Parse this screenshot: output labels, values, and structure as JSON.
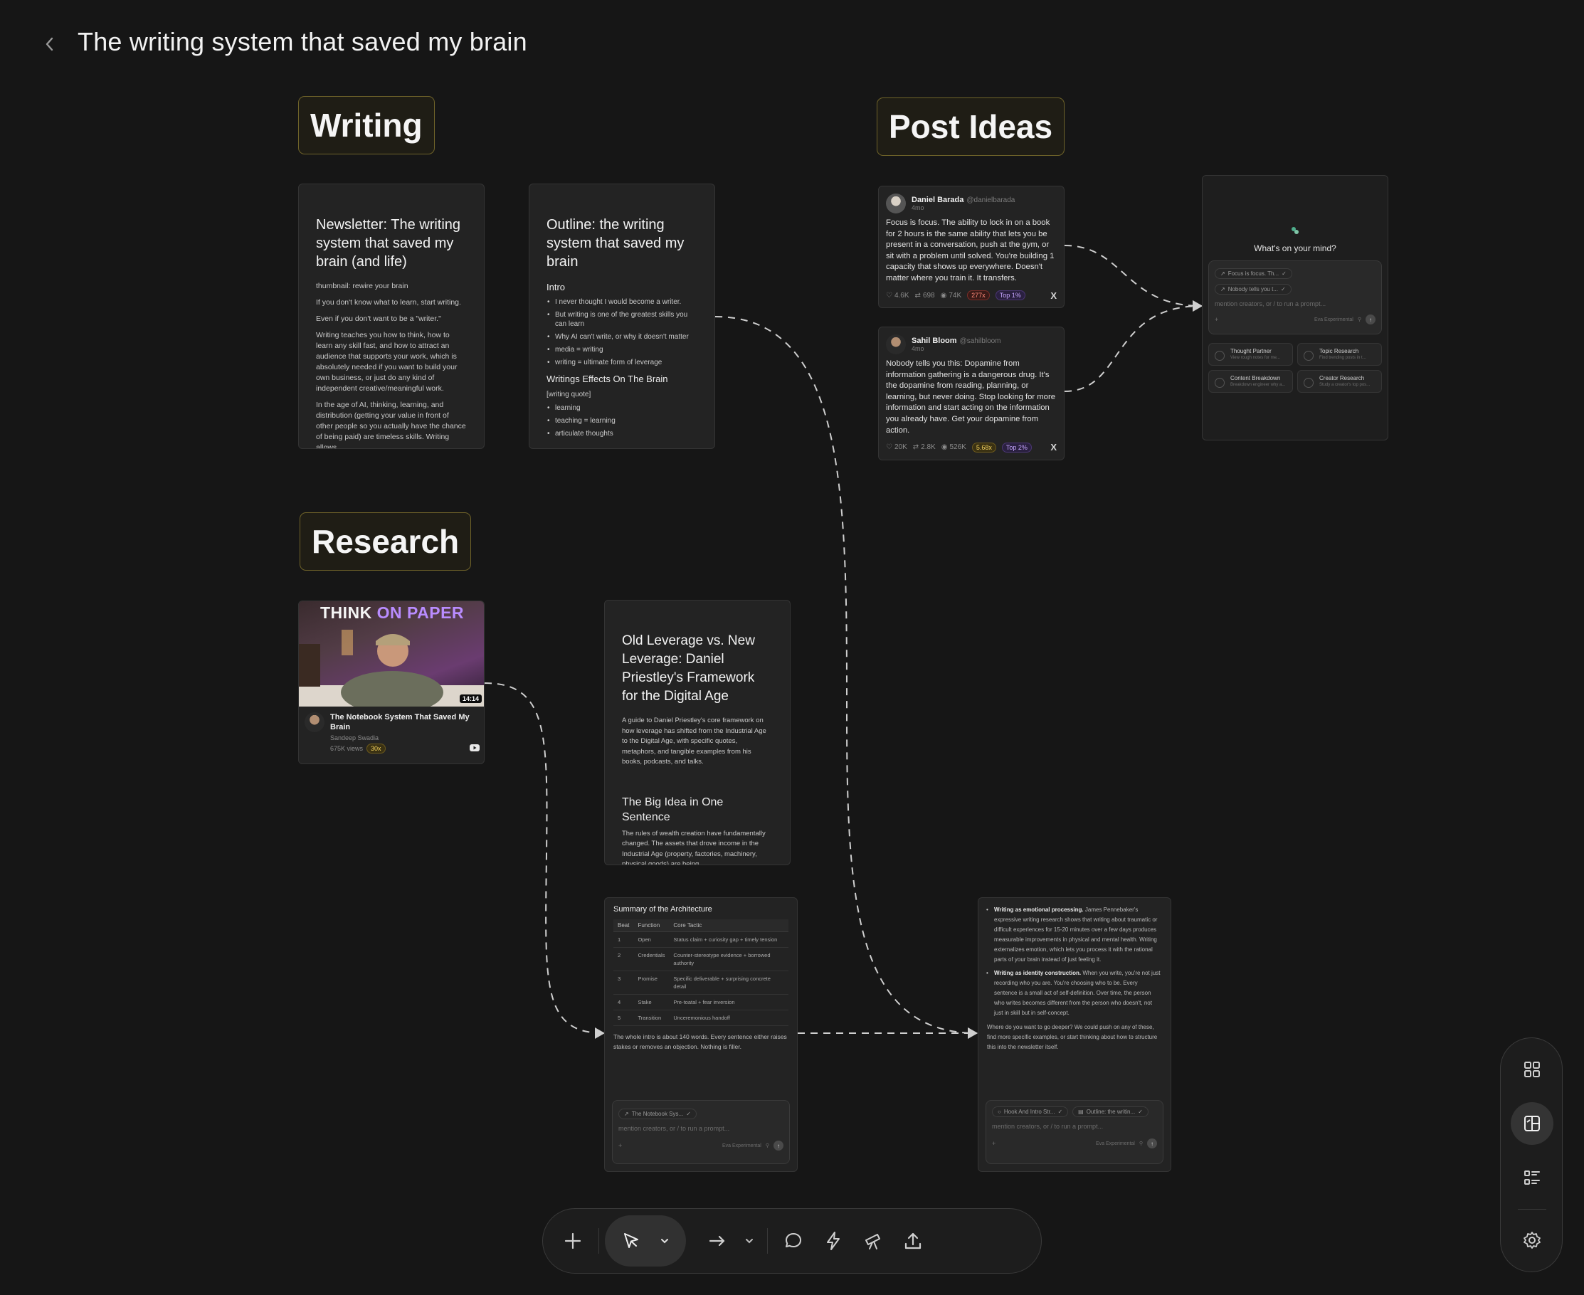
{
  "header": {
    "title": "The writing system that saved my brain"
  },
  "sections": {
    "writing": "Writing",
    "post_ideas": "Post Ideas",
    "research": "Research"
  },
  "newsletter_card": {
    "title": "Newsletter: The writing system that saved my brain (and life)",
    "paragraphs": [
      "thumbnail: rewire your brain",
      "If you don't know what to learn, start writing.",
      "Even if you don't want to be a \"writer.\"",
      "Writing teaches you how to think, how to learn any skill fast, and how to attract an audience that supports your work, which is absolutely needed if you want to build your own business, or just do any kind of independent creative/meaningful work.",
      "In the age of AI, thinking, learning, and distribution (getting your value in front of other people so you actually have the chance of being paid) are timeless skills. Writing allows"
    ]
  },
  "outline_card": {
    "title": "Outline: the writing system that saved my brain",
    "intro_heading": "Intro",
    "intro_items": [
      "I never thought I would become a writer.",
      "But writing is one of the greatest skills you can learn",
      "Why AI can't write, or why it doesn't matter",
      "media = writing",
      "writing = ultimate form of leverage"
    ],
    "effects_heading": "Writings Effects On The Brain",
    "effects_quote": "[writing quote]",
    "effects_items": [
      "learning",
      "teaching = learning",
      "articulate thoughts"
    ]
  },
  "tweets": [
    {
      "name": "Daniel Barada",
      "handle": "@danielbarada",
      "time": "4mo",
      "body": "Focus is focus. The ability to lock in on a book for 2 hours is the same ability that lets you be present in a conversation, push at the gym, or sit with a problem until solved. You're building 1 capacity that shows up everywhere. Doesn't matter where you train it. It transfers.",
      "likes": "4.6K",
      "reposts": "698",
      "views": "74K",
      "badge1": "277x",
      "badge2": "Top 1%",
      "x_label": "X"
    },
    {
      "name": "Sahil Bloom",
      "handle": "@sahilbloom",
      "time": "4mo",
      "body": "Nobody tells you this: Dopamine from information gathering is a dangerous drug. It's the dopamine from reading, planning, or learning, but never doing. Stop looking for more information and start acting on the information you already have. Get your dopamine from action.",
      "likes": "20K",
      "reposts": "2.8K",
      "views": "526K",
      "badge1": "5.68x",
      "badge2": "Top 2%",
      "x_label": "X"
    }
  ],
  "mind_panel": {
    "question": "What's on your mind?",
    "chip1": "Focus is focus. Th...",
    "chip2": "Nobody tells you t...",
    "placeholder": "mention creators, or / to run a prompt...",
    "model": "Eva Experimental",
    "tools": [
      {
        "title": "Thought Partner",
        "sub": "View rough notes for me..."
      },
      {
        "title": "Topic Research",
        "sub": "Find trending posts in t..."
      },
      {
        "title": "Content Breakdown",
        "sub": "Breakdown engineer why a..."
      },
      {
        "title": "Creator Research",
        "sub": "Study a creator's top pos..."
      }
    ]
  },
  "video_card": {
    "thumb_title_a": "THINK ",
    "thumb_title_b": "ON PAPER",
    "duration": "14:14",
    "title": "The Notebook System That Saved My Brain",
    "channel": "Sandeep Swadia",
    "views": "675K views",
    "badge": "30x"
  },
  "leverage_card": {
    "title": "Old Leverage vs. New Leverage: Daniel Priestley's Framework for the Digital Age",
    "desc": "A guide to Daniel Priestley's core framework on how leverage has shifted from the Industrial Age to the Digital Age, with specific quotes, metaphors, and tangible examples from his books, podcasts, and talks.",
    "subheading": "The Big Idea in One Sentence",
    "subtext": "The rules of wealth creation have fundamentally changed. The assets that drove income in the Industrial Age (property, factories, machinery, physical goods) are being"
  },
  "architecture_card": {
    "title": "Summary of the Architecture",
    "columns": [
      "Beat",
      "Function",
      "Core Tactic"
    ],
    "rows": [
      [
        "1",
        "Open",
        "Status claim + curiosity gap + timely tension"
      ],
      [
        "2",
        "Credentials",
        "Counter-stereotype evidence + borrowed authority"
      ],
      [
        "3",
        "Promise",
        "Specific deliverable + surprising concrete detail"
      ],
      [
        "4",
        "Stake",
        "Pre-toatal + fear inversion"
      ],
      [
        "5",
        "Transition",
        "Unceremonious handoff"
      ]
    ],
    "summary": "The whole intro is about 140 words. Every sentence either raises stakes or removes an objection. Nothing is filler.",
    "chip": "The Notebook Sys...",
    "placeholder": "mention creators, or / to run a prompt...",
    "model": "Eva Experimental"
  },
  "writing_research_card": {
    "bullet1_title": "Writing as emotional processing.",
    "bullet1_text": " James Pennebaker's expressive writing research shows that writing about traumatic or difficult experiences for 15-20 minutes over a few days produces measurable improvements in physical and mental health. Writing externalizes emotion, which lets you process it with the rational parts of your brain instead of just feeling it.",
    "bullet2_title": "Writing as identity construction.",
    "bullet2_text": " When you write, you're not just recording who you are. You're choosing who to be. Every sentence is a small act of self-definition. Over time, the person who writes becomes different from the person who doesn't, not just in skill but in self-concept.",
    "closing": "Where do you want to go deeper? We could push on any of these, find more specific examples, or start thinking about how to structure this into the newsletter itself.",
    "chip1": "Hook And Intro Str...",
    "chip2": "Outline: the writin...",
    "placeholder": "mention creators, or / to run a prompt...",
    "model": "Eva Experimental"
  },
  "colors": {
    "background": "#161616",
    "card": "#232323",
    "section_border": "#6f6329",
    "accent_purple": "#b98cff"
  }
}
